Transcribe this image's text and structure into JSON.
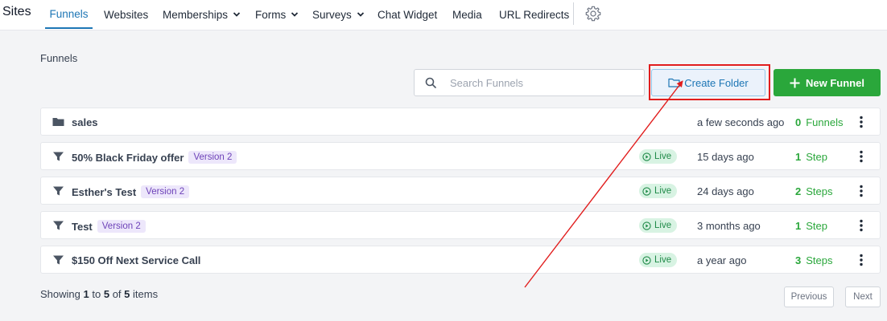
{
  "colors": {
    "accent": "#1d76b5",
    "primary_green": "#2aa73b",
    "annotation_red": "#e11d1d",
    "badge_purple": "#6d42b8",
    "live_green": "#1f8a48"
  },
  "brand": "Sites",
  "nav": {
    "tabs": [
      {
        "label": "Funnels",
        "active": true
      },
      {
        "label": "Websites"
      },
      {
        "label": "Memberships",
        "dropdown": true
      },
      {
        "label": "Forms",
        "dropdown": true
      },
      {
        "label": "Surveys",
        "dropdown": true
      },
      {
        "label": "Chat Widget"
      },
      {
        "label": "Media"
      },
      {
        "label": "URL Redirects"
      }
    ],
    "settings_icon": "gear-icon"
  },
  "page": {
    "title": "Funnels",
    "search_placeholder": "Search Funnels",
    "create_folder_label": "Create Folder",
    "new_funnel_label": "New Funnel"
  },
  "rows": [
    {
      "type": "folder",
      "icon": "folder-icon",
      "name": "sales",
      "badge": "",
      "live": "",
      "when": "a few seconds ago",
      "count": "0",
      "count_label": "Funnels"
    },
    {
      "type": "funnel",
      "icon": "funnel-icon",
      "name": "50% Black Friday offer",
      "badge": "Version 2",
      "live": "Live",
      "when": "15 days ago",
      "count": "1",
      "count_label": "Step"
    },
    {
      "type": "funnel",
      "icon": "funnel-icon",
      "name": "Esther's Test",
      "badge": "Version 2",
      "live": "Live",
      "when": "24 days ago",
      "count": "2",
      "count_label": "Steps"
    },
    {
      "type": "funnel",
      "icon": "funnel-icon",
      "name": "Test",
      "badge": "Version 2",
      "live": "Live",
      "when": "3 months ago",
      "count": "1",
      "count_label": "Step"
    },
    {
      "type": "funnel",
      "icon": "funnel-icon",
      "name": "$150 Off Next Service Call",
      "badge": "",
      "live": "Live",
      "when": "a year ago",
      "count": "3",
      "count_label": "Steps"
    }
  ],
  "pagination": {
    "showing_prefix": "Showing",
    "from": "1",
    "to_word": "to",
    "to": "5",
    "of_word": "of",
    "total": "5",
    "suffix": "items",
    "previous_label": "Previous",
    "next_label": "Next"
  }
}
